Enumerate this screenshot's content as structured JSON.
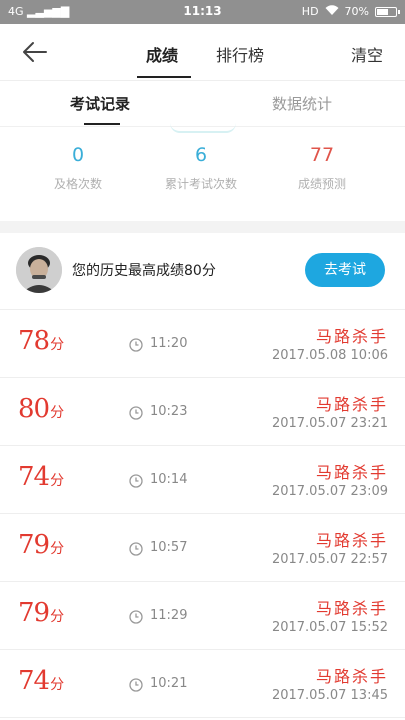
{
  "status_bar": {
    "network": "4G",
    "time": "11:13",
    "hd": "HD",
    "battery_percent": "70%",
    "battery_level": 0.7
  },
  "header": {
    "tabs": [
      {
        "label": "成绩",
        "active": true
      },
      {
        "label": "排行榜",
        "active": false
      }
    ],
    "clear_label": "清空"
  },
  "subtabs": [
    {
      "label": "考试记录",
      "active": true
    },
    {
      "label": "数据统计",
      "active": false
    }
  ],
  "stats": [
    {
      "value": "0",
      "label": "及格次数",
      "color": "#3aaed8"
    },
    {
      "value": "6",
      "label": "累计考试次数",
      "color": "#3aaed8"
    },
    {
      "value": "77",
      "label": "成绩预测",
      "color": "#e0554b"
    }
  ],
  "best": {
    "text": "您的历史最高成绩80分",
    "button_label": "去考试"
  },
  "records": [
    {
      "score": "78",
      "unit": "分",
      "duration": "11:20",
      "user": "马路杀手",
      "date": "2017.05.08  10:06"
    },
    {
      "score": "80",
      "unit": "分",
      "duration": "10:23",
      "user": "马路杀手",
      "date": "2017.05.07  23:21"
    },
    {
      "score": "74",
      "unit": "分",
      "duration": "10:14",
      "user": "马路杀手",
      "date": "2017.05.07  23:09"
    },
    {
      "score": "79",
      "unit": "分",
      "duration": "10:57",
      "user": "马路杀手",
      "date": "2017.05.07  22:57"
    },
    {
      "score": "79",
      "unit": "分",
      "duration": "11:29",
      "user": "马路杀手",
      "date": "2017.05.07  15:52"
    },
    {
      "score": "74",
      "unit": "分",
      "duration": "10:21",
      "user": "马路杀手",
      "date": "2017.05.07  13:45"
    }
  ],
  "colors": {
    "accent_blue": "#1ea7e0",
    "score_red": "#e23a30"
  }
}
